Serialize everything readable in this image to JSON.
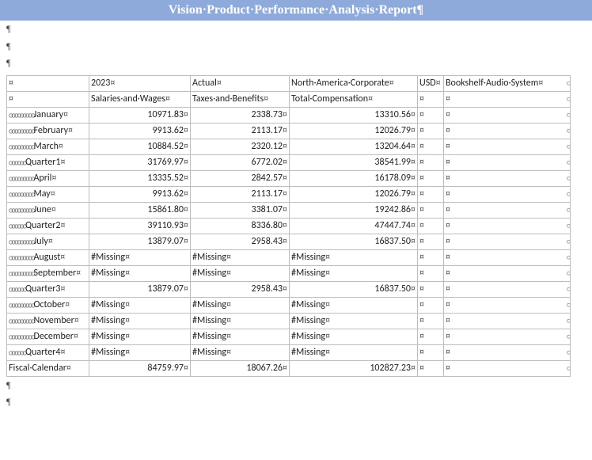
{
  "title": "Vision·Product·Performance·Analysis·Report¶",
  "pilcrow": "¶",
  "headers": {
    "row0": [
      "",
      "2023",
      "Actual",
      "North·America·Corporate",
      "USD",
      "Bookshelf·Audio·System"
    ],
    "row1": [
      "",
      "Salaries·and·Wages",
      "Taxes·and·Benefits",
      "Total·Compensation",
      "",
      ""
    ]
  },
  "rows": [
    {
      "indent": 3,
      "label": "January",
      "a": "10971.83",
      "b": "2338.73",
      "c": "13310.56"
    },
    {
      "indent": 3,
      "label": "February",
      "a": "9913.62",
      "b": "2113.17",
      "c": "12026.79"
    },
    {
      "indent": 3,
      "label": "March",
      "a": "10884.52",
      "b": "2320.12",
      "c": "13204.64"
    },
    {
      "indent": 2,
      "label": "Quarter1",
      "a": "31769.97",
      "b": "6772.02",
      "c": "38541.99"
    },
    {
      "indent": 3,
      "label": "April",
      "a": "13335.52",
      "b": "2842.57",
      "c": "16178.09"
    },
    {
      "indent": 3,
      "label": "May",
      "a": "9913.62",
      "b": "2113.17",
      "c": "12026.79"
    },
    {
      "indent": 3,
      "label": "June",
      "a": "15861.80",
      "b": "3381.07",
      "c": "19242.86"
    },
    {
      "indent": 2,
      "label": "Quarter2",
      "a": "39110.93",
      "b": "8336.80",
      "c": "47447.74"
    },
    {
      "indent": 3,
      "label": "July",
      "a": "13879.07",
      "b": "2958.43",
      "c": "16837.50"
    },
    {
      "indent": 3,
      "label": "August",
      "a": "#Missing",
      "b": "#Missing",
      "c": "#Missing",
      "missing": true
    },
    {
      "indent": 3,
      "label": "September",
      "a": "#Missing",
      "b": "#Missing",
      "c": "#Missing",
      "missing": true
    },
    {
      "indent": 2,
      "label": "Quarter3",
      "a": "13879.07",
      "b": "2958.43",
      "c": "16837.50"
    },
    {
      "indent": 3,
      "label": "October",
      "a": "#Missing",
      "b": "#Missing",
      "c": "#Missing",
      "missing": true
    },
    {
      "indent": 3,
      "label": "November",
      "a": "#Missing",
      "b": "#Missing",
      "c": "#Missing",
      "missing": true
    },
    {
      "indent": 3,
      "label": "December",
      "a": "#Missing",
      "b": "#Missing",
      "c": "#Missing",
      "missing": true
    },
    {
      "indent": 2,
      "label": "Quarter4",
      "a": "#Missing",
      "b": "#Missing",
      "c": "#Missing",
      "missing": true
    },
    {
      "indent": 0,
      "label": "Fiscal·Calendar",
      "a": "84759.97",
      "b": "18067.26",
      "c": "102827.23"
    }
  ]
}
